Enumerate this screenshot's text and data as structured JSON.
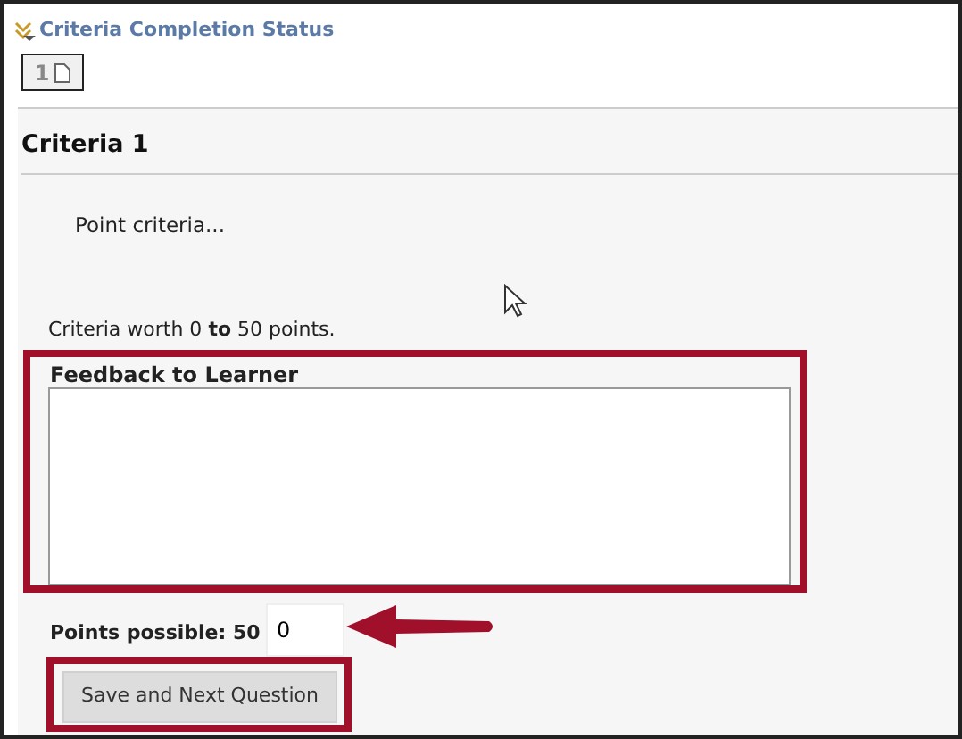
{
  "header": {
    "title": "Criteria Completion Status",
    "page_button": "1"
  },
  "criteria": {
    "heading": "Criteria 1",
    "description": "Point criteria...",
    "range_text": "Criteria worth 0 **to** 50 points."
  },
  "feedback": {
    "label": "Feedback to Learner"
  },
  "points": {
    "label": "Points possible: 50",
    "value": "0"
  },
  "buttons": [
    "Save and Next Question"
  ]
}
